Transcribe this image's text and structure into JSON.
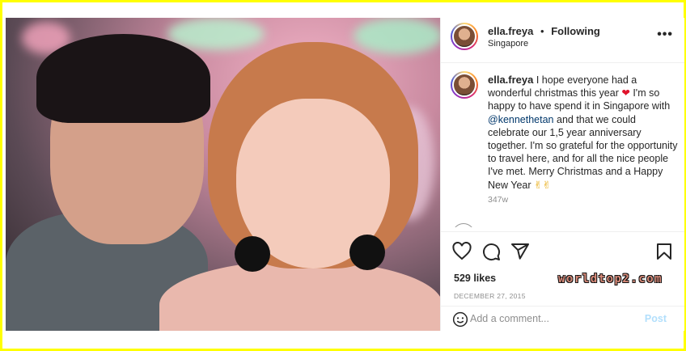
{
  "post": {
    "username": "ella.freya",
    "follow_separator": "•",
    "follow_status": "Following",
    "location": "Singapore",
    "more_icon": "more-horizontal-icon"
  },
  "caption": {
    "username": "ella.freya",
    "text_part1": "I hope everyone had a wonderful christmas this year",
    "heart": "❤",
    "text_part2": "I'm so happy to have spend it in Singapore with",
    "mention": "@kennethetan",
    "text_part3": "and that we could celebrate our 1,5 year anniversary together. I'm so grateful for the opportunity to travel here, and for all the nice people I've met. Merry Christmas and a Happy New Year",
    "emoji": "✌✌",
    "time_ago": "347w"
  },
  "actions": {
    "like_icon": "heart-icon",
    "comment_icon": "comment-icon",
    "share_icon": "share-icon",
    "save_icon": "bookmark-icon",
    "likes": "529 likes",
    "date": "DECEMBER 27, 2015",
    "watermark": "worldtop2.com"
  },
  "comment_bar": {
    "emoji_icon": "smiley-icon",
    "placeholder": "Add a comment...",
    "post_label": "Post"
  },
  "colors": {
    "frame": "#ffff00",
    "mention": "#00376b",
    "heart": "#e0132b",
    "post_button": "#b2dffc"
  }
}
